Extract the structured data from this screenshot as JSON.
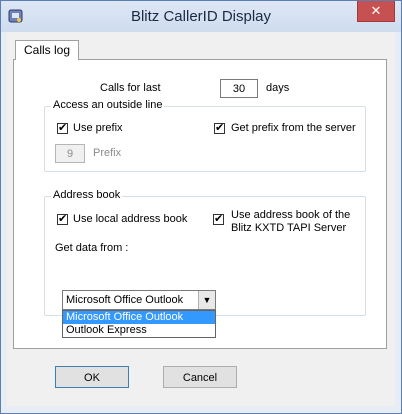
{
  "window": {
    "title": "Blitz CallerID Display",
    "close_glyph": "✕"
  },
  "tabs": [
    {
      "label": "Calls log"
    }
  ],
  "calls": {
    "label": "Calls for last",
    "value": "30",
    "unit": "days"
  },
  "outside_line": {
    "group_title": "Access an outside line",
    "use_prefix": {
      "label": "Use prefix",
      "checked": true
    },
    "get_prefix": {
      "label": "Get prefix from the server",
      "checked": true
    },
    "prefix_value": "9",
    "prefix_label": "Prefix"
  },
  "address_book": {
    "group_title": "Address book",
    "use_local": {
      "label": "Use local address book",
      "checked": true
    },
    "use_kxtd": {
      "label_line1": "Use address book of the",
      "label_line2": "Blitz KXTD TAPI Server",
      "checked": true
    },
    "get_data_label": "Get data from :",
    "selected": "Microsoft Office Outlook",
    "options": [
      "Microsoft Office Outlook",
      "Outlook Express"
    ]
  },
  "buttons": {
    "ok": "OK",
    "cancel": "Cancel"
  },
  "icons": {
    "app": "phone-app-icon",
    "close": "close-icon",
    "combo_arrow": "chevron-down-icon"
  }
}
